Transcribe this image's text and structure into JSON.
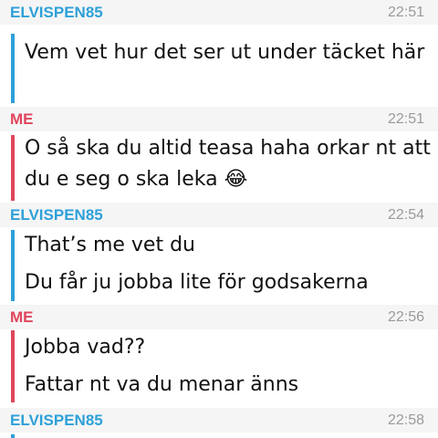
{
  "chat": {
    "groups": [
      {
        "sender": "ELVISPEN85",
        "time": "22:51",
        "messages": [
          "Vem vet hur det ser ut under täcket här"
        ]
      },
      {
        "sender": "ME",
        "time": "22:51",
        "messages": [
          "O så ska du altid teasa haha orkar nt att du e seg o ska leka 😂"
        ]
      },
      {
        "sender": "ELVISPEN85",
        "time": "22:54",
        "messages": [
          "That’s me vet du",
          "Du får ju jobba lite för godsakerna"
        ]
      },
      {
        "sender": "ME",
        "time": "22:56",
        "messages": [
          "Jobba vad??",
          "Fattar nt va du menar änns"
        ]
      },
      {
        "sender": "ELVISPEN85",
        "time": "22:58",
        "messages": []
      }
    ]
  },
  "colors": {
    "them": "#2ea0d8",
    "me": "#e0455c",
    "header_bg": "#f5f5f5",
    "timestamp": "#9a9a9a"
  }
}
